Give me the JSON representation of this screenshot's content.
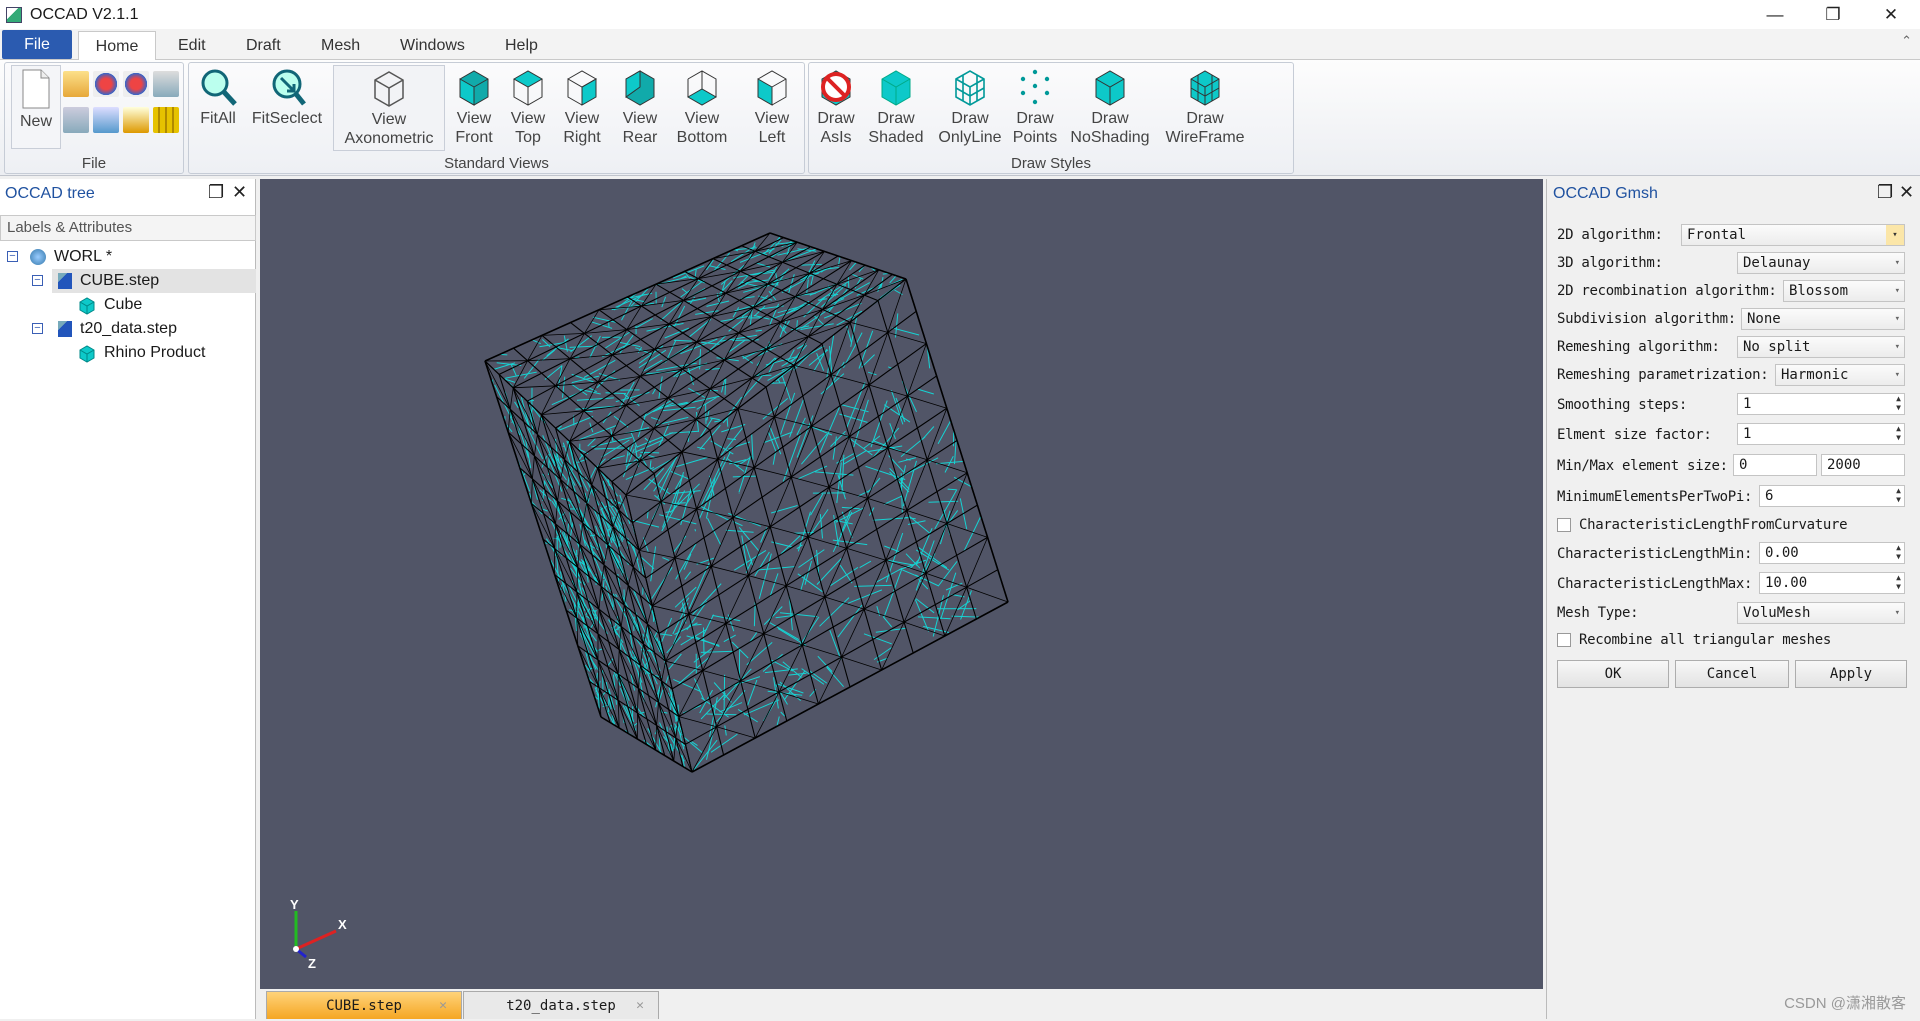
{
  "window": {
    "title": "OCCAD V2.1.1",
    "min_glyph": "—",
    "max_glyph": "❐",
    "close_glyph": "✕"
  },
  "menu": {
    "file": "File",
    "home": "Home",
    "edit": "Edit",
    "draft": "Draft",
    "mesh": "Mesh",
    "windows": "Windows",
    "help": "Help",
    "collapse_glyph": "⌃"
  },
  "ribbon": {
    "file_group": "File",
    "new": "New",
    "standard_views_group": "Standard Views",
    "draw_styles_group": "Draw Styles",
    "fitall": "FitAll",
    "fitselect": "FitSeclect",
    "axo": [
      "View",
      "Axonometric"
    ],
    "front": [
      "View",
      "Front"
    ],
    "top": [
      "View",
      "Top"
    ],
    "right": [
      "View",
      "Right"
    ],
    "rear": [
      "View",
      "Rear"
    ],
    "bottom": [
      "View",
      "Bottom"
    ],
    "left": [
      "View",
      "Left"
    ],
    "asis": [
      "Draw",
      "AsIs"
    ],
    "shaded": [
      "Draw",
      "Shaded"
    ],
    "onlyline": [
      "Draw",
      "OnlyLine"
    ],
    "points": [
      "Draw",
      "Points"
    ],
    "noshading": [
      "Draw",
      "NoShading"
    ],
    "wireframe": [
      "Draw",
      "WireFrame"
    ]
  },
  "tree": {
    "title": "OCCAD tree",
    "header": "Labels & Attributes",
    "items": [
      {
        "label": "WORL *"
      },
      {
        "label": "CUBE.step"
      },
      {
        "label": "Cube"
      },
      {
        "label": "t20_data.step"
      },
      {
        "label": "Rhino Product"
      }
    ]
  },
  "doc_tabs": [
    {
      "label": "CUBE.step"
    },
    {
      "label": "t20_data.step"
    }
  ],
  "axis": {
    "x": "X",
    "y": "Y",
    "z": "Z"
  },
  "panel": {
    "title": "OCCAD Gmsh",
    "alg2d_label": "2D algorithm:",
    "alg2d": "Frontal",
    "alg3d_label": "3D algorithm:",
    "alg3d": "Delaunay",
    "recomb_label": "2D recombination algorithm:",
    "recomb": "Blossom",
    "subdiv_label": "Subdivision algorithm:",
    "subdiv": "None",
    "remesh_label": "Remeshing algorithm:",
    "remesh": "No split",
    "remeshparam_label": "Remeshing parametrization:",
    "remeshparam": "Harmonic",
    "smooth_label": "Smoothing steps:",
    "smooth": "1",
    "sizefactor_label": "Elment size factor:",
    "sizefactor": "1",
    "minmax_label": "Min/Max element size:",
    "min": "0",
    "max": "2000",
    "minelem_label": "MinimumElementsPerTwoPi:",
    "minelem": "6",
    "charcurv_label": "CharacteristicLengthFromCurvature",
    "clmin_label": "CharacteristicLengthMin:",
    "clmin": "0.00",
    "clmax_label": "CharacteristicLengthMax:",
    "clmax": "10.00",
    "meshtype_label": "Mesh Type:",
    "mesh_type": "VoluMesh",
    "recombine_label": "Recombine all triangular meshes",
    "ok": "OK",
    "cancel": "Cancel",
    "apply": "Apply"
  },
  "watermark": "CSDN @潇湘散客",
  "colors": {
    "viewport": "#515567",
    "mesh_line": "#16d3d3",
    "wire": "#000000",
    "accent": "#2b5bb0"
  }
}
